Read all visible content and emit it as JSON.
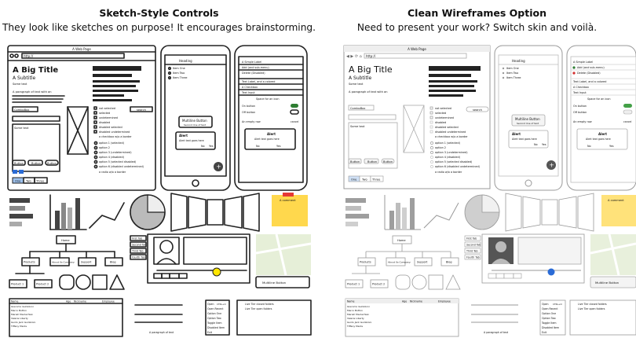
{
  "left_header": {
    "title": "Sketch-Style Controls",
    "subtitle": "They look like sketches on purpose! It encourages brainstorming."
  },
  "right_header": {
    "title": "Clean Wireframes Option",
    "subtitle": "Need to present your work? Switch skin and voilà."
  },
  "mock": {
    "window_title": "A Web Page",
    "url": "http://",
    "big_title": "A Big Title",
    "subtitle": "A Subtitle",
    "some_text": "Some text",
    "paragraph_prefix": "A paragraph of text with an",
    "paragraph_link": "unassigned link",
    "combo": "ComboBox",
    "textarea": "Some text",
    "search": "search",
    "checkboxes": [
      "not selected",
      "selected",
      "undetermined",
      "disabled",
      "disabled selected",
      "disabled undetermined"
    ],
    "checkbox_no_border": "a checkbox w/o a border",
    "radios": [
      "option 1 (selected)",
      "option 2",
      "option 3 (undetermined)",
      "option 4 (disabled)",
      "option 5 (selected disabled)",
      "option 6 (disabled undetermined)"
    ],
    "radio_no_border": "a radio w/o a border",
    "buttons": [
      "Button",
      "Button",
      "Button"
    ],
    "tabs": [
      "One",
      "Two",
      "Three"
    ],
    "heading": "Heading",
    "list_items": [
      "Item One",
      "Item Two",
      "Item Three"
    ],
    "multiline_button": "Multiline Button",
    "multiline_second": "Second line of text",
    "alert_title": "Alert",
    "alert_text": "Alert text goes here",
    "alert_no": "No",
    "alert_yes": "Yes",
    "phone_items": [
      "A Simple Label",
      "Add (and sub-menu)",
      "Delete (Disabled)",
      "Text Label, and a colored",
      "A Checkbox",
      "Text Input"
    ],
    "phone_spacer": "Space for an icon",
    "phone_toggles": [
      "On button",
      "Off button"
    ],
    "phone_empty": "An empty row",
    "cancel": "cancel",
    "comment": "A comment",
    "flow_home": "Home",
    "flow_level2": [
      "Products",
      "About Us Company",
      "Support",
      "Blog"
    ],
    "flow_level3": [
      "Product 1",
      "Product 2"
    ],
    "tab_labels": [
      "First Tab",
      "Second Tab",
      "Third Tab",
      "Fourth Tab"
    ],
    "multiline_bottom": "Multiline Button",
    "table_headers": [
      "Name",
      "Age",
      "Nickname",
      "Employee"
    ],
    "table_rows": [
      "Giacomo Guilizzoni",
      "Marco Botton",
      "Mariah Maclachlan",
      "Valerie Liberty",
      "Guido Jack Guilizzoni",
      "Tiffany Marks"
    ],
    "folder_items": [
      "Live Tier closed folders",
      "Live Tier open folders"
    ],
    "caption": "A paragraph of text",
    "menu_items": [
      "Open",
      "Open Recent",
      "Option One",
      "Option Two",
      "Toggle Item",
      "Disabled Item",
      "Exit"
    ],
    "menu_shortcut": "CTRL+O"
  }
}
